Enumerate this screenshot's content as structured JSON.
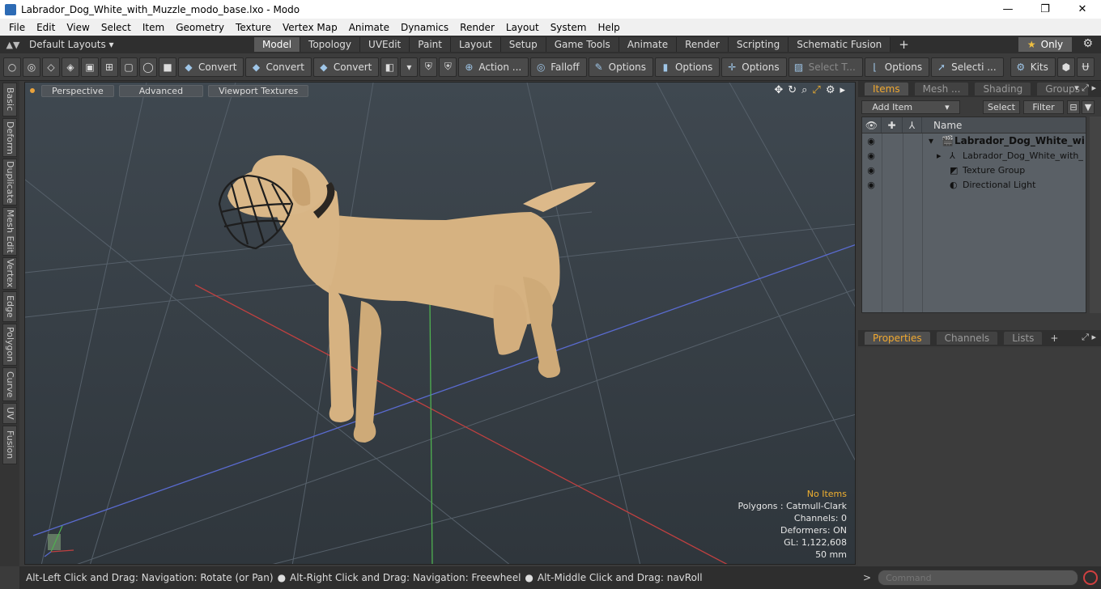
{
  "window": {
    "title": "Labrador_Dog_White_with_Muzzle_modo_base.lxo - Modo",
    "minimize": "—",
    "maximize": "❐",
    "close": "✕"
  },
  "menu": [
    "File",
    "Edit",
    "View",
    "Select",
    "Item",
    "Geometry",
    "Texture",
    "Vertex Map",
    "Animate",
    "Dynamics",
    "Render",
    "Layout",
    "System",
    "Help"
  ],
  "layoutbar": {
    "layouts_label": "Default Layouts ▾",
    "tabs": [
      "Model",
      "Topology",
      "UVEdit",
      "Paint",
      "Layout",
      "Setup",
      "Game Tools",
      "Animate",
      "Render",
      "Scripting",
      "Schematic Fusion"
    ],
    "active_tab": "Model",
    "plus": "+",
    "only_label": "Only",
    "star": "★",
    "gear": "⚙"
  },
  "toolbar": {
    "convert_1": "Convert",
    "convert_2": "Convert",
    "convert_3": "Convert",
    "action": "Action ...",
    "falloff": "Falloff",
    "options_1": "Options",
    "options_2": "Options",
    "options_3": "Options",
    "select_t": "Select T...",
    "options_4": "Options",
    "selecti": "Selecti ...",
    "kits": "Kits"
  },
  "left_tabs": [
    "Basic",
    "Deform",
    "Duplicate",
    "Mesh Edit",
    "Vertex",
    "Edge",
    "Polygon",
    "Curve",
    "UV",
    "Fusion"
  ],
  "viewport": {
    "perspective": "Perspective",
    "advanced": "Advanced",
    "textures": "Viewport Textures",
    "info": {
      "no_items": "No Items",
      "polygons": "Polygons : Catmull-Clark",
      "channels": "Channels: 0",
      "deformers": "Deformers: ON",
      "gl": "GL: 1,122,608",
      "mm": "50 mm"
    }
  },
  "status": {
    "seg1": "Alt-Left Click and Drag: Navigation: Rotate (or Pan)",
    "seg2": "Alt-Right Click and Drag: Navigation: Freewheel",
    "seg3": "Alt-Middle Click and Drag: navRoll",
    "bullet": "●"
  },
  "items_panel": {
    "tabs": [
      "Items",
      "Mesh ...",
      "Shading",
      "Groups"
    ],
    "active_tab": "Items",
    "add_item": "Add Item",
    "select": "Select",
    "filter": "Filter",
    "name_col": "Name",
    "rows": [
      {
        "name": "Labrador_Dog_White_wit ..."
      },
      {
        "name": "Labrador_Dog_White_with_ ..."
      },
      {
        "name": "Texture Group"
      },
      {
        "name": "Directional Light"
      }
    ]
  },
  "props_panel": {
    "tabs": [
      "Properties",
      "Channels",
      "Lists"
    ],
    "active_tab": "Properties",
    "plus": "+"
  },
  "command": {
    "placeholder": "Command",
    "arrow": ">"
  },
  "colors": {
    "accent": "#f0a830",
    "active_tab": "#5a5a5a"
  }
}
